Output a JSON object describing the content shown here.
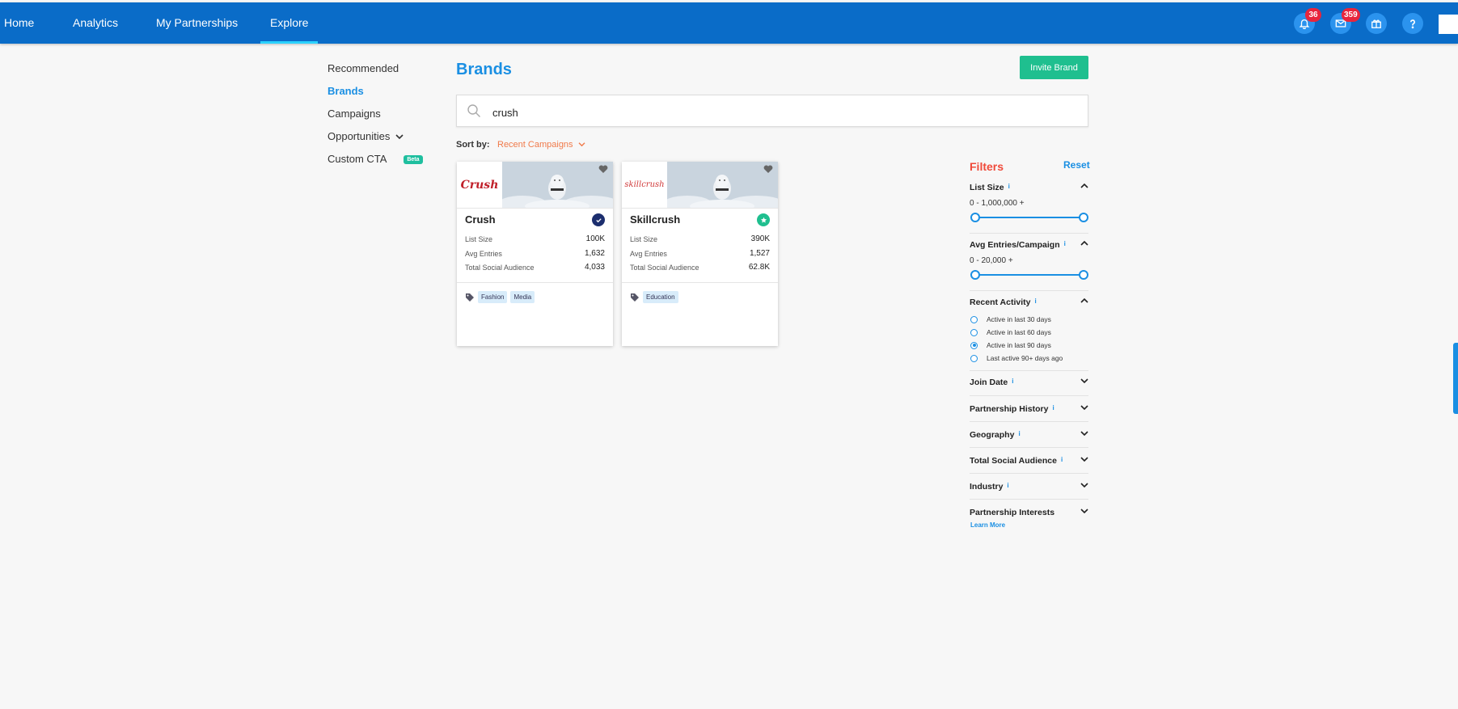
{
  "nav": {
    "items": [
      {
        "label": "Home"
      },
      {
        "label": "Analytics"
      },
      {
        "label": "My Partnerships"
      },
      {
        "label": "Explore"
      }
    ],
    "notifications_count": "36",
    "messages_count": "359"
  },
  "sidebar": {
    "items": [
      {
        "label": "Recommended"
      },
      {
        "label": "Brands"
      },
      {
        "label": "Campaigns"
      },
      {
        "label": "Opportunities"
      },
      {
        "label": "Custom CTA"
      }
    ],
    "beta_label": "Beta"
  },
  "header": {
    "title": "Brands",
    "invite_label": "Invite Brand"
  },
  "search": {
    "value": "crush"
  },
  "sort": {
    "label": "Sort by:",
    "value": "Recent Campaigns"
  },
  "cards": [
    {
      "name": "Crush",
      "logo_text": "Crush",
      "stats": [
        {
          "label": "List Size",
          "value": "100K"
        },
        {
          "label": "Avg Entries",
          "value": "1,632"
        },
        {
          "label": "Total Social Audience",
          "value": "4,033"
        }
      ],
      "tags": [
        "Fashion",
        "Media"
      ],
      "badge_color": "#1c2e6e"
    },
    {
      "name": "Skillcrush",
      "logo_text": "skillcrush",
      "stats": [
        {
          "label": "List Size",
          "value": "390K"
        },
        {
          "label": "Avg Entries",
          "value": "1,527"
        },
        {
          "label": "Total Social Audience",
          "value": "62.8K"
        }
      ],
      "tags": [
        "Education"
      ],
      "badge_color": "#1fbf8f"
    }
  ],
  "filters": {
    "title": "Filters",
    "reset_label": "Reset",
    "list_size": {
      "label": "List Size",
      "range": "0 - 1,000,000 +"
    },
    "avg_entries": {
      "label": "Avg Entries/Campaign",
      "range": "0 - 20,000 +"
    },
    "recent_activity": {
      "label": "Recent Activity",
      "options": [
        "Active in last 30 days",
        "Active in last 60 days",
        "Active in last 90 days",
        "Last active 90+ days ago"
      ],
      "selected": "Active in last 90 days"
    },
    "collapsed": [
      {
        "label": "Join Date"
      },
      {
        "label": "Partnership History"
      },
      {
        "label": "Geography"
      },
      {
        "label": "Total Social Audience"
      },
      {
        "label": "Industry"
      },
      {
        "label": "Partnership Interests"
      }
    ],
    "learn_more_label": "Learn More",
    "info_glyph": "i"
  },
  "colors": {
    "nav_bg": "#0a6cc8",
    "accent_blue": "#1a8fe3",
    "accent_green": "#1fbf8f",
    "accent_orange": "#f07a4a",
    "filters_red": "#f04a3a",
    "badge_red": "#e8253c"
  }
}
